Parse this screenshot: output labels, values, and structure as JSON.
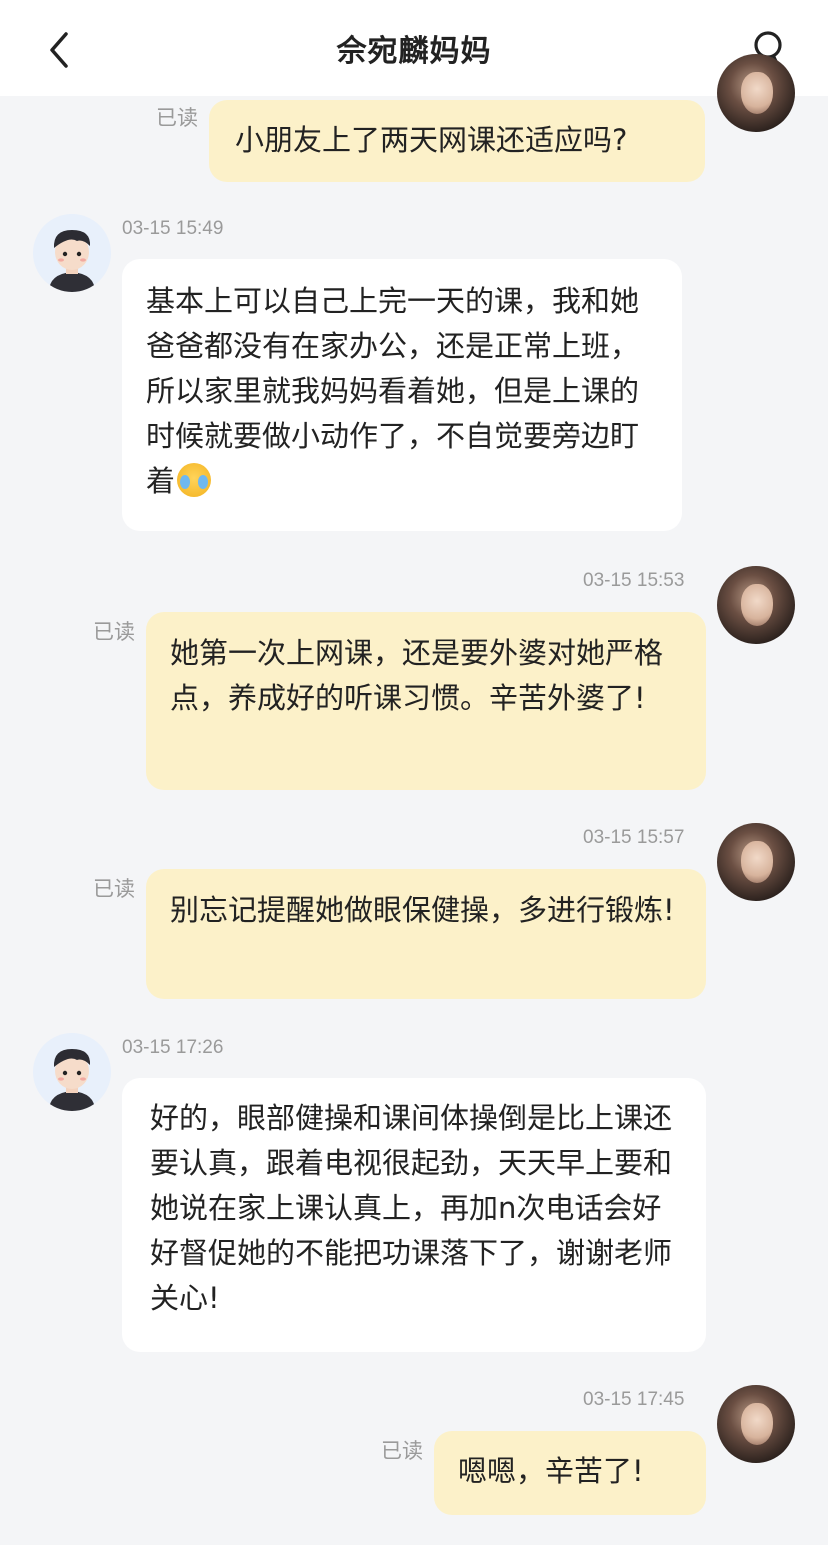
{
  "header": {
    "title": "佘宛麟妈妈",
    "back_icon": "chevron-left-icon",
    "profile_icon": "person-icon"
  },
  "messages": [
    {
      "sender": "teacher",
      "read_label": "已读",
      "text": "小朋友上了两天网课还适应吗?"
    },
    {
      "sender": "parent",
      "timestamp": "03-15 15:49",
      "text": "基本上可以自己上完一天的课，我和她爸爸都没有在家办公，还是正常上班，所以家里就我妈妈看着她，但是上课的时候就要做小动作了，不自觉要旁边盯着",
      "emoji": "crying-laughing-emoji"
    },
    {
      "sender": "teacher",
      "timestamp": "03-15 15:53",
      "read_label": "已读",
      "text": "她第一次上网课，还是要外婆对她严格点，养成好的听课习惯。辛苦外婆了!"
    },
    {
      "sender": "teacher",
      "timestamp": "03-15 15:57",
      "read_label": "已读",
      "text": "别忘记提醒她做眼保健操，多进行锻炼!"
    },
    {
      "sender": "parent",
      "timestamp": "03-15 17:26",
      "text": "好的，眼部健操和课间体操倒是比上课还要认真，跟着电视很起劲，天天早上要和她说在家上课认真上，再加n次电话会好好督促她的不能把功课落下了，谢谢老师关心!"
    },
    {
      "sender": "teacher",
      "timestamp": "03-15 17:45",
      "read_label": "已读",
      "text": "嗯嗯，辛苦了!"
    }
  ],
  "colors": {
    "outgoing_bubble": "#fcf1c9",
    "incoming_bubble": "#ffffff",
    "background": "#f4f5f7",
    "meta_text": "#9a9a9a"
  }
}
